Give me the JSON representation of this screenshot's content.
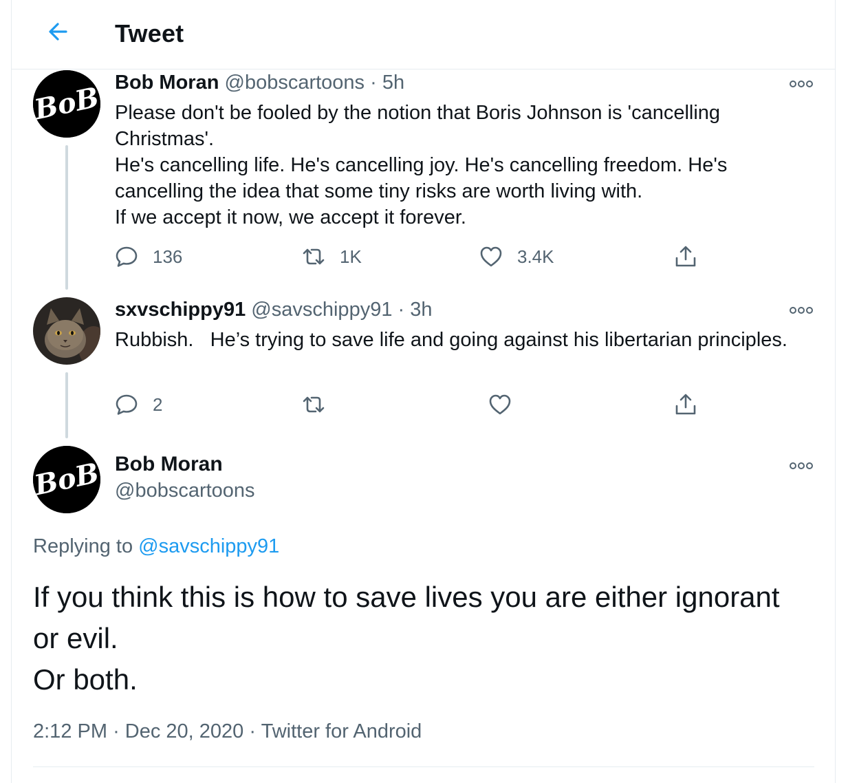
{
  "header": {
    "title": "Tweet",
    "back_icon": "arrow-left-icon",
    "accent": "#1d9bf0"
  },
  "thread": [
    {
      "avatar_text": "BoB",
      "name": "Bob Moran",
      "handle": "@bobscartoons",
      "time": "5h",
      "text": "Please don't be fooled by the notion that Boris Johnson is 'cancelling Christmas'.\nHe's cancelling life. He's cancelling joy. He's cancelling freedom. He's cancelling the idea that some tiny risks are worth living with.\nIf we accept it now, we accept it forever.",
      "stats": {
        "replies": "136",
        "retweets": "1K",
        "likes": "3.4K"
      }
    },
    {
      "avatar_icon": "cat-avatar",
      "name": "sxvschippy91",
      "handle": "@savschippy91",
      "time": "3h",
      "text": "Rubbish.   He’s trying to save life and going against his libertarian principles.",
      "stats": {
        "replies": "2",
        "retweets": "",
        "likes": ""
      }
    }
  ],
  "main_tweet": {
    "avatar_text": "BoB",
    "name": "Bob Moran",
    "handle": "@bobscartoons",
    "replying_prefix": "Replying to",
    "replying_to": "@savschippy91",
    "text": "If you think this is how to save lives you are either ignorant or evil.\nOr both.",
    "time": "2:12 PM",
    "date": "Dec 20, 2020",
    "source": "Twitter for Android",
    "separator": "·"
  }
}
